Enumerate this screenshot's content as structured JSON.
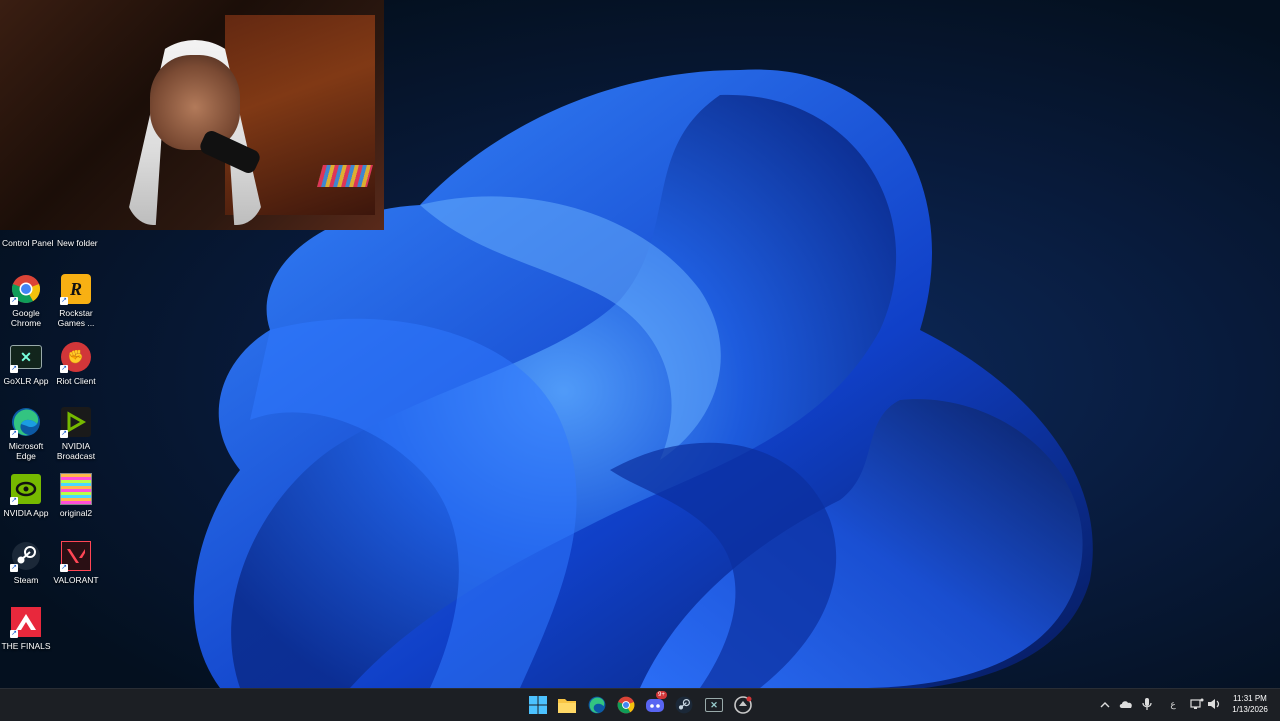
{
  "webcam": {
    "description": ""
  },
  "desktop": {
    "top_labels": {
      "control_panel": "Control Panel",
      "new_folder": "New folder"
    },
    "icons": [
      {
        "label": "Google Chrome",
        "icon": "chrome-icon"
      },
      {
        "label": "Rockstar Games ...",
        "icon": "rockstar-icon"
      },
      {
        "label": "GoXLR App",
        "icon": "goxlr-icon"
      },
      {
        "label": "Riot Client",
        "icon": "riot-icon"
      },
      {
        "label": "Microsoft Edge",
        "icon": "edge-icon"
      },
      {
        "label": "NVIDIA Broadcast",
        "icon": "nvidia-broadcast-icon"
      },
      {
        "label": "NVIDIA App",
        "icon": "nvidia-icon"
      },
      {
        "label": "original2",
        "icon": "image-file-icon"
      },
      {
        "label": "Steam",
        "icon": "steam-icon"
      },
      {
        "label": "VALORANT",
        "icon": "valorant-icon"
      },
      {
        "label": "THE FINALS",
        "icon": "the-finals-icon"
      }
    ]
  },
  "taskbar": {
    "apps": [
      {
        "icon": "start-icon"
      },
      {
        "icon": "file-explorer-icon"
      },
      {
        "icon": "edge-icon"
      },
      {
        "icon": "chrome-icon"
      },
      {
        "icon": "discord-icon",
        "badge": "9+"
      },
      {
        "icon": "steam-icon"
      },
      {
        "icon": "goxlr-icon"
      },
      {
        "icon": "riot-icon"
      }
    ],
    "tray": {
      "language": "ع",
      "time": "11:31 PM",
      "date": "1/13/2026"
    }
  },
  "colors": {
    "taskbar_bg": "#1c1f24",
    "accent": "#2f8cff",
    "chrome_red": "#db4437",
    "nvidia_green": "#76b900",
    "riot_red": "#d13639",
    "valorant_red": "#ff4655"
  }
}
